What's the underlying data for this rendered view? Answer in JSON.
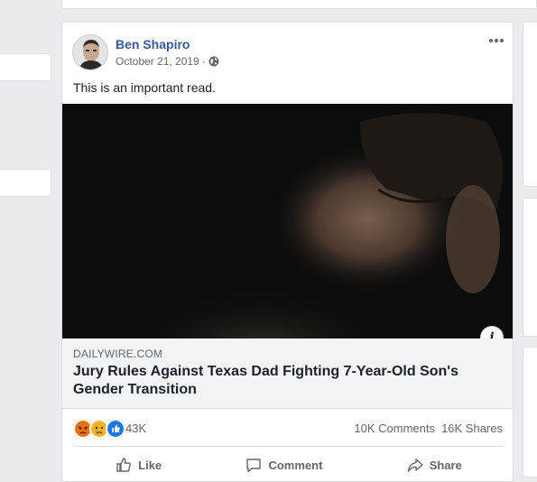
{
  "post": {
    "author": "Ben Shapiro",
    "date": "October 21, 2019",
    "date_separator": "·",
    "audience_icon": "globe-icon",
    "text": "This is an important read.",
    "more_icon": "more-horizontal-icon"
  },
  "link_preview": {
    "domain": "DAILYWIRE.COM",
    "title": "Jury Rules Against Texas Dad Fighting 7-Year-Old Son's Gender Transition",
    "info_label": "i"
  },
  "stats": {
    "reactions": [
      "angry",
      "sad",
      "like"
    ],
    "reaction_count": "43K",
    "comments": "10K Comments",
    "shares": "16K Shares"
  },
  "actions": {
    "like": "Like",
    "comment": "Comment",
    "share": "Share"
  },
  "colors": {
    "author_link": "#385898",
    "page_bg": "#e9ebee",
    "like_blue": "#1877f2",
    "angry": "#e9710f",
    "sad": "#f7b125"
  }
}
